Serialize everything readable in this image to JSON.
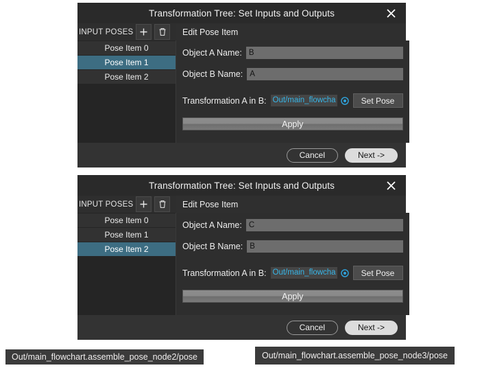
{
  "dialogs": [
    {
      "title": "Transformation Tree: Set Inputs and Outputs",
      "close_icon": "close-icon",
      "list_header": "INPUT POSES",
      "add_icon": "plus-icon",
      "delete_icon": "trash-icon",
      "section_label": "Edit Pose Item",
      "items": [
        {
          "label": "Pose Item 0",
          "selected": false
        },
        {
          "label": "Pose Item 1",
          "selected": true
        },
        {
          "label": "Pose Item 2",
          "selected": false
        }
      ],
      "object_a_label": "Object A Name:",
      "object_a_value": "B",
      "object_b_label": "Object B Name:",
      "object_b_value": "A",
      "transform_label": "Transformation A in B:",
      "transform_value": "Out/main_flowcha",
      "target_icon": "target-radio-icon",
      "set_pose_label": "Set Pose",
      "apply_label": "Apply",
      "cancel_label": "Cancel",
      "next_label": "Next ->"
    },
    {
      "title": "Transformation Tree: Set Inputs and Outputs",
      "close_icon": "close-icon",
      "list_header": "INPUT POSES",
      "add_icon": "plus-icon",
      "delete_icon": "trash-icon",
      "section_label": "Edit Pose Item",
      "items": [
        {
          "label": "Pose Item 0",
          "selected": false
        },
        {
          "label": "Pose Item 1",
          "selected": false
        },
        {
          "label": "Pose Item 2",
          "selected": true
        }
      ],
      "object_a_label": "Object A Name:",
      "object_a_value": "C",
      "object_b_label": "Object B Name:",
      "object_b_value": "B",
      "transform_label": "Transformation A in B:",
      "transform_value": "Out/main_flowcha",
      "target_icon": "target-radio-icon",
      "set_pose_label": "Set Pose",
      "apply_label": "Apply",
      "cancel_label": "Cancel",
      "next_label": "Next ->"
    }
  ],
  "tooltips": [
    {
      "text": "Out/main_flowchart.assemble_pose_node2/pose"
    },
    {
      "text": "Out/main_flowchart.assemble_pose_node3/pose"
    }
  ],
  "colors": {
    "dialog_background": "#2c2c2c",
    "selection_blue": "#3d6d82",
    "link_blue": "#37b6e8",
    "primary_button": "#dcdcdc",
    "input_field": "#6d6d6d",
    "tooltip_background": "#3b3b3b"
  }
}
